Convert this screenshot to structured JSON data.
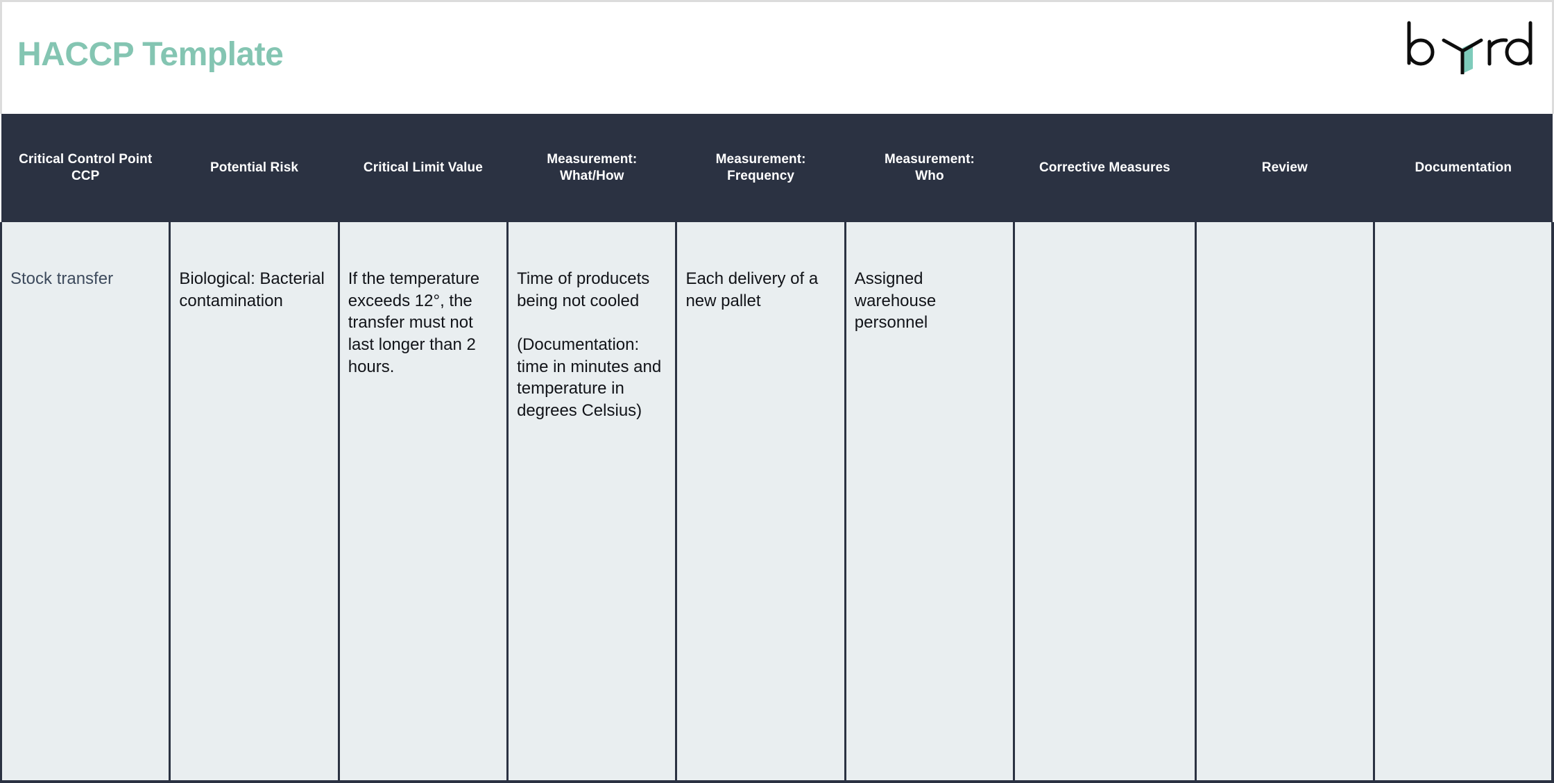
{
  "document": {
    "title": "HACCP Template",
    "title_color": "#84c5b2"
  },
  "brand": {
    "name": "byrd",
    "letter_1": "b",
    "letter_2": "y",
    "letter_3": "r",
    "letter_4": "d",
    "accent_color": "#7ecbbb",
    "ink_color": "#0d0d0d"
  },
  "table": {
    "header_bg": "#2b3242",
    "body_bg": "#e9eef0",
    "border_color": "#2b3242",
    "columns": [
      {
        "line1": "Critical Control Point",
        "line2": "CCP"
      },
      {
        "line1": "Potential Risk",
        "line2": ""
      },
      {
        "line1": "Critical Limit Value",
        "line2": ""
      },
      {
        "line1": "Measurement:",
        "line2": "What/How"
      },
      {
        "line1": "Measurement:",
        "line2": "Frequency"
      },
      {
        "line1": "Measurement:",
        "line2": "Who"
      },
      {
        "line1": "Corrective Measures",
        "line2": ""
      },
      {
        "line1": "Review",
        "line2": ""
      },
      {
        "line1": "Documentation",
        "line2": ""
      }
    ],
    "rows": [
      {
        "ccp": "Stock transfer",
        "potential_risk": "Biological: Bacterial contamination",
        "critical_limit_value": "If the temperature exceeds 12°, the transfer must not last longer than 2 hours.",
        "measurement_what_how_1": "Time of producets being not cooled",
        "measurement_what_how_2": "(Documentation: time in minutes and temperature in degrees Celsius)",
        "measurement_frequency": "Each delivery of a new pallet",
        "measurement_who": "Assigned warehouse personnel",
        "corrective_measures": "",
        "review": "",
        "documentation": ""
      }
    ]
  }
}
